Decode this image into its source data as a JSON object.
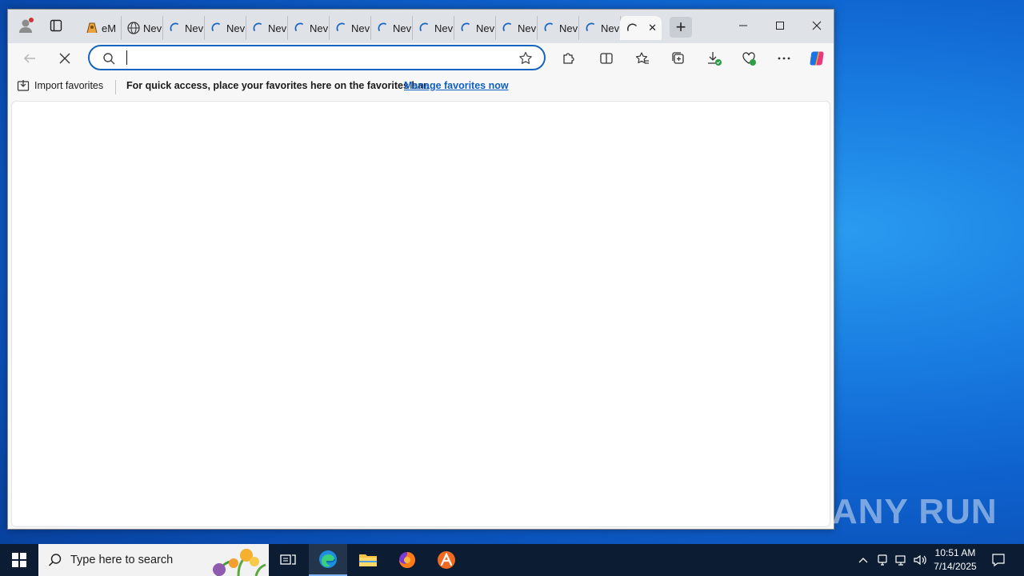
{
  "browser": {
    "tabs": [
      {
        "label": "eM",
        "icon": "emoji-icon"
      },
      {
        "label": "Nev",
        "icon": "globe-icon"
      },
      {
        "label": "Nev",
        "icon": "loading-spinner-icon"
      },
      {
        "label": "Nev",
        "icon": "loading-spinner-icon"
      },
      {
        "label": "Nev",
        "icon": "loading-spinner-icon"
      },
      {
        "label": "Nev",
        "icon": "loading-spinner-icon"
      },
      {
        "label": "Nev",
        "icon": "loading-spinner-icon"
      },
      {
        "label": "Nev",
        "icon": "loading-spinner-icon"
      },
      {
        "label": "Nev",
        "icon": "loading-spinner-icon"
      },
      {
        "label": "Nev",
        "icon": "loading-spinner-icon"
      },
      {
        "label": "Nev",
        "icon": "loading-spinner-icon"
      },
      {
        "label": "Nev",
        "icon": "loading-spinner-icon"
      },
      {
        "label": "Nev",
        "icon": "loading-spinner-icon"
      }
    ],
    "active_tab": {
      "label": "",
      "icon": "loading-spinner-icon",
      "close": "✕"
    },
    "new_tab": "+",
    "address": {
      "value": "",
      "placeholder": ""
    },
    "favorites_bar": {
      "import_label": "Import favorites",
      "message": "For quick access, place your favorites here on the favorites bar.",
      "manage_link": "Manage favorites now"
    },
    "accent_color": "#1565c0"
  },
  "watermark": "ANY RUN",
  "taskbar": {
    "search_placeholder": "Type here to search",
    "time": "10:51 AM",
    "date": "7/14/2025"
  }
}
